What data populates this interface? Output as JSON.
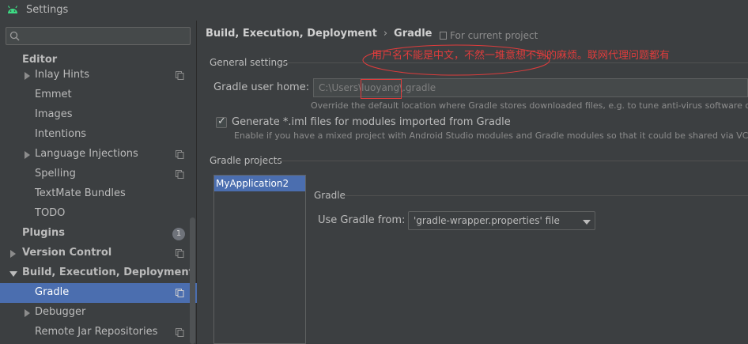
{
  "window": {
    "title": "Settings"
  },
  "colors": {
    "accent": "#4b6eaf",
    "annotation": "#e03c3c"
  },
  "search": {
    "placeholder": ""
  },
  "sidebar": {
    "items": [
      {
        "label": "Editor"
      },
      {
        "label": "Inlay Hints"
      },
      {
        "label": "Emmet"
      },
      {
        "label": "Images"
      },
      {
        "label": "Intentions"
      },
      {
        "label": "Language Injections"
      },
      {
        "label": "Spelling"
      },
      {
        "label": "TextMate Bundles"
      },
      {
        "label": "TODO"
      },
      {
        "label": "Plugins",
        "badge": "1"
      },
      {
        "label": "Version Control"
      },
      {
        "label": "Build, Execution, Deployment"
      },
      {
        "label": "Gradle"
      },
      {
        "label": "Debugger"
      },
      {
        "label": "Remote Jar Repositories"
      }
    ]
  },
  "main": {
    "breadcrumb": {
      "parent": "Build, Execution, Deployment",
      "separator": "›",
      "current": "Gradle"
    },
    "for_project": "For current project",
    "general_settings_title": "General settings",
    "gradle_user_home_label": "Gradle user home:",
    "gradle_user_home_value": "C:\\Users\\luoyang\\.gradle",
    "gradle_user_home_hint": "Override the default location where Gradle stores downloaded files, e.g. to tune anti-virus software on Wi",
    "generate_iml_label": "Generate *.iml files for modules imported from Gradle",
    "generate_iml_checked": true,
    "generate_iml_hint": "Enable if you have a mixed project with Android Studio modules and Gradle modules so that it could be shared via VCS",
    "gradle_projects_title": "Gradle projects",
    "projects": [
      "MyApplication2"
    ],
    "gradle_section_title": "Gradle",
    "use_gradle_from_label": "Use Gradle from:",
    "use_gradle_from_value": "'gradle-wrapper.properties' file"
  },
  "annotation": {
    "text": "用户名不能是中文，不然一堆意想不到的麻烦。联网代理问题都有"
  }
}
